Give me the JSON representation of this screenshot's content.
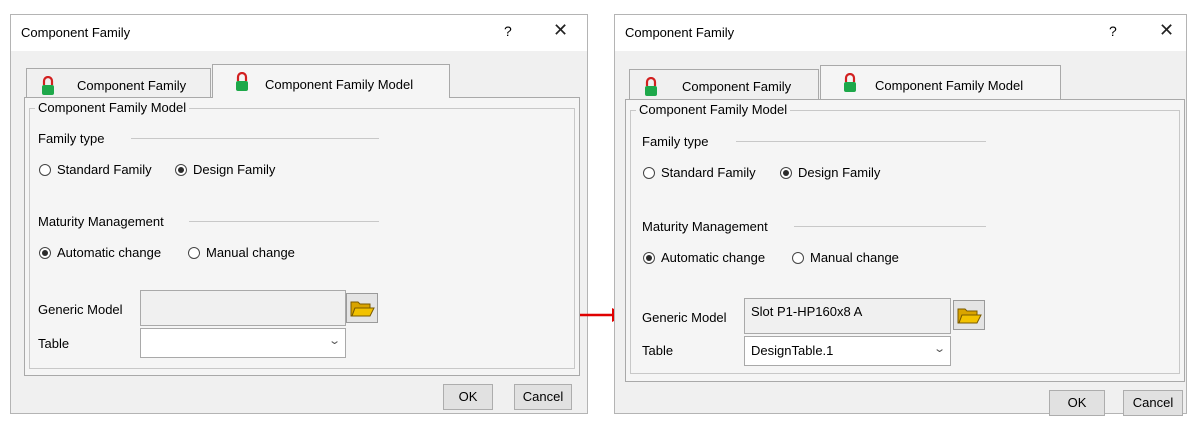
{
  "left_dialog": {
    "title": "Component Family",
    "help_label": "?",
    "close_label": "✕",
    "tabs": [
      {
        "label": "Component Family",
        "active": false
      },
      {
        "label": "Component Family Model",
        "active": true
      }
    ],
    "group_title": "Component Family Model",
    "family_type": {
      "label": "Family type",
      "options": [
        {
          "label": "Standard Family",
          "selected": false
        },
        {
          "label": "Design Family",
          "selected": true
        }
      ]
    },
    "maturity": {
      "label": "Maturity Management",
      "options": [
        {
          "label": "Automatic change",
          "selected": true
        },
        {
          "label": "Manual change",
          "selected": false
        }
      ]
    },
    "generic_model": {
      "label": "Generic Model",
      "value": ""
    },
    "table": {
      "label": "Table",
      "value": ""
    },
    "buttons": {
      "ok": "OK",
      "cancel": "Cancel"
    }
  },
  "right_dialog": {
    "title": "Component Family",
    "help_label": "?",
    "close_label": "✕",
    "tabs": [
      {
        "label": "Component Family",
        "active": false
      },
      {
        "label": "Component Family Model",
        "active": true
      }
    ],
    "group_title": "Component Family Model",
    "family_type": {
      "label": "Family type",
      "options": [
        {
          "label": "Standard Family",
          "selected": false
        },
        {
          "label": "Design Family",
          "selected": true
        }
      ]
    },
    "maturity": {
      "label": "Maturity Management",
      "options": [
        {
          "label": "Automatic change",
          "selected": true
        },
        {
          "label": "Manual change",
          "selected": false
        }
      ]
    },
    "generic_model": {
      "label": "Generic Model",
      "value": "Slot P1-HP160x8 A"
    },
    "table": {
      "label": "Table",
      "value": "DesignTable.1"
    },
    "buttons": {
      "ok": "OK",
      "cancel": "Cancel"
    }
  },
  "icons": {
    "lock": "lock-icon",
    "folder": "open-folder-icon",
    "dropdown": "chevron-down-icon"
  },
  "colors": {
    "highlight": "#e00000",
    "lock_body": "#1ea84a",
    "lock_shackle": "#d22020",
    "folder": "#f2c200"
  }
}
